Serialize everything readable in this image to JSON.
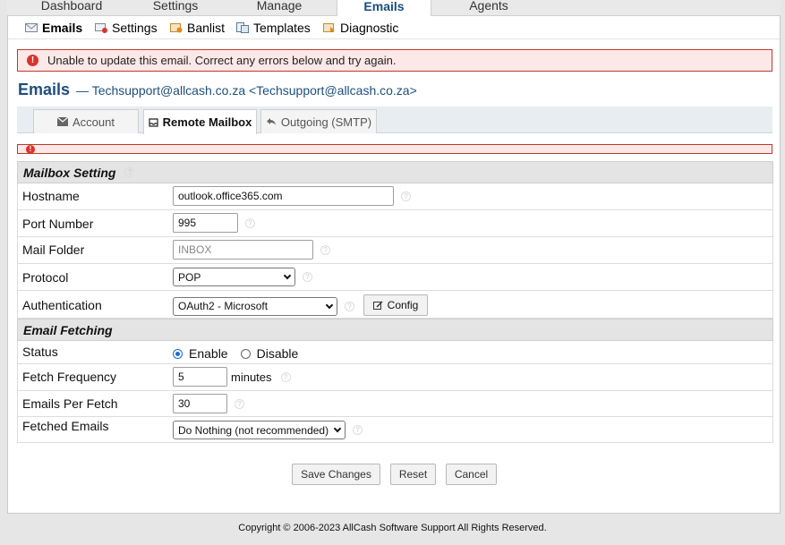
{
  "topnav": {
    "tabs": [
      {
        "label": "Dashboard"
      },
      {
        "label": "Settings"
      },
      {
        "label": "Manage"
      },
      {
        "label": "Emails",
        "active": true
      },
      {
        "label": "Agents"
      }
    ]
  },
  "subnav": {
    "items": [
      {
        "label": "Emails",
        "icon": "envelope-icon",
        "active": true
      },
      {
        "label": "Settings",
        "icon": "settings-icon"
      },
      {
        "label": "Banlist",
        "icon": "banlist-icon"
      },
      {
        "label": "Templates",
        "icon": "templates-icon"
      },
      {
        "label": "Diagnostic",
        "icon": "diagnostic-icon"
      }
    ]
  },
  "error": {
    "message": "Unable to update this email. Correct any errors below and try again.",
    "icon": "!"
  },
  "page": {
    "title": "Emails",
    "subtitle": "— Techsupport@allcash.co.za <Techsupport@allcash.co.za>"
  },
  "tabs": [
    {
      "label": "Account",
      "icon": "envelope-icon"
    },
    {
      "label": "Remote Mailbox",
      "icon": "inbox-icon",
      "active": true
    },
    {
      "label": "Outgoing (SMTP)",
      "icon": "reply-icon"
    }
  ],
  "sections": {
    "mailbox": {
      "title": "Mailbox Setting",
      "help": "?"
    },
    "fetching": {
      "title": "Email Fetching"
    }
  },
  "fields": {
    "hostname": {
      "label": "Hostname",
      "value": "outlook.office365.com"
    },
    "port": {
      "label": "Port Number",
      "value": "995"
    },
    "folder": {
      "label": "Mail Folder",
      "placeholder": "INBOX"
    },
    "protocol": {
      "label": "Protocol",
      "value": "POP"
    },
    "auth": {
      "label": "Authentication",
      "value": "OAuth2 - Microsoft",
      "config_label": "Config"
    },
    "status": {
      "label": "Status",
      "enable_label": "Enable",
      "disable_label": "Disable",
      "selected": "Enable"
    },
    "frequency": {
      "label": "Fetch Frequency",
      "value": "5",
      "unit": "minutes"
    },
    "per_fetch": {
      "label": "Emails Per Fetch",
      "value": "30"
    },
    "fetched": {
      "label": "Fetched Emails",
      "value": "Do Nothing (not recommended)"
    }
  },
  "buttons": {
    "save": "Save Changes",
    "reset": "Reset",
    "cancel": "Cancel"
  },
  "footer": {
    "text": "Copyright © 2006-2023 AllCash Software Support All Rights Reserved."
  },
  "colors": {
    "accent": "#1d4f7e",
    "error_border": "#c0392b",
    "error_bg": "#fde8e8",
    "radio": "#1a6dd8"
  }
}
